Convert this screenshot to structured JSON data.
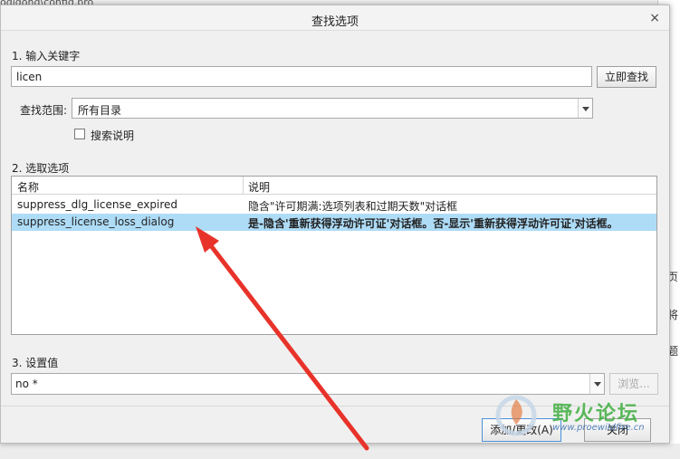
{
  "background": {
    "path_fragment": "ogidong\\config.pro",
    "right_edge_chars": [
      "页",
      "将",
      "题"
    ]
  },
  "dialog": {
    "title": "查找选项",
    "close_glyph": "×",
    "step1": {
      "heading": "1.  输入关键字",
      "keyword_value": "licen",
      "find_button": "立即查找",
      "scope_label": "查找范围:",
      "scope_value": "所有目录",
      "search_desc_label": "搜索说明",
      "search_desc_checked": false
    },
    "step2": {
      "heading": "2.  选取选项",
      "columns": [
        "名称",
        "说明"
      ],
      "rows": [
        {
          "name": "suppress_dlg_license_expired",
          "desc": "隐含\"许可期满:选项列表和过期天数\"对话框",
          "selected": false
        },
        {
          "name": "suppress_license_loss_dialog",
          "desc": "是-隐含'重新获得浮动许可证'对话框。否-显示'重新获得浮动许可证'对话框。",
          "selected": true
        }
      ]
    },
    "step3": {
      "heading": "3.  设置值",
      "value": "no *",
      "browse_button": "浏览..."
    },
    "footer": {
      "add_change_button": "添加/更改(A)",
      "close_button": "关闭"
    }
  },
  "watermark": {
    "text_cn": "野火论坛",
    "url": "www.proewildfire.cn"
  },
  "colors": {
    "selection": "#aedcf7",
    "arrow": "#e8332a",
    "watermark_green": "#3fae3f"
  }
}
